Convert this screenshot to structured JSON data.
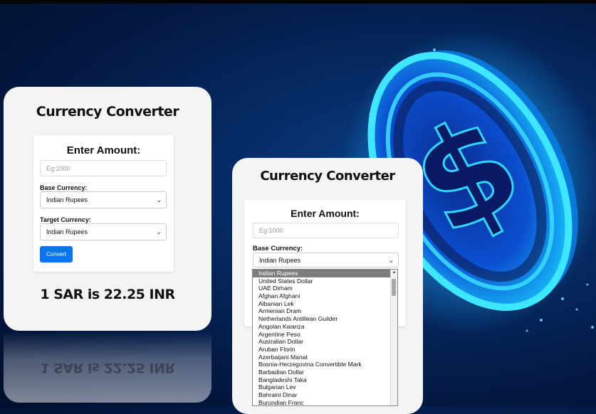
{
  "colors": {
    "button": "#0b74ef",
    "card": "#f4f4f4",
    "background": "#062a63",
    "coin_glow": "#27d4ff"
  },
  "card_left": {
    "title": "Currency Converter",
    "amount_label": "Enter Amount:",
    "amount_placeholder": "Eg:1000",
    "base_label": "Base Currency:",
    "base_value": "Indian Rupees",
    "target_label": "Target Currency:",
    "target_value": "Indian Rupees",
    "convert_label": "Convert",
    "result": "1 SAR is 22.25 INR"
  },
  "card_right": {
    "title": "Currency Converter",
    "amount_label": "Enter Amount:",
    "amount_placeholder": "Eg:1000",
    "base_label": "Base Currency:",
    "base_value": "Indian Rupees"
  },
  "dropdown_options": [
    "Indian Rupees",
    "United States Dollar",
    "UAE Dirham",
    "Afghan Afghani",
    "Albanian Lek",
    "Armenian Dram",
    "Netherlands Antillean Guilder",
    "Angolan Kwanza",
    "Argentine Peso",
    "Australian Dollar",
    "Aruban Florin",
    "Azerbaijani Manat",
    "Bosnia-Herzegovina Convertible Mark",
    "Barbadian Dollar",
    "Bangladeshi Taka",
    "Bulgarian Lev",
    "Bahraini Dinar",
    "Burundian Franc"
  ],
  "icons": {
    "coin": "dollar-coin-icon",
    "select": "chevron-down-icon"
  }
}
